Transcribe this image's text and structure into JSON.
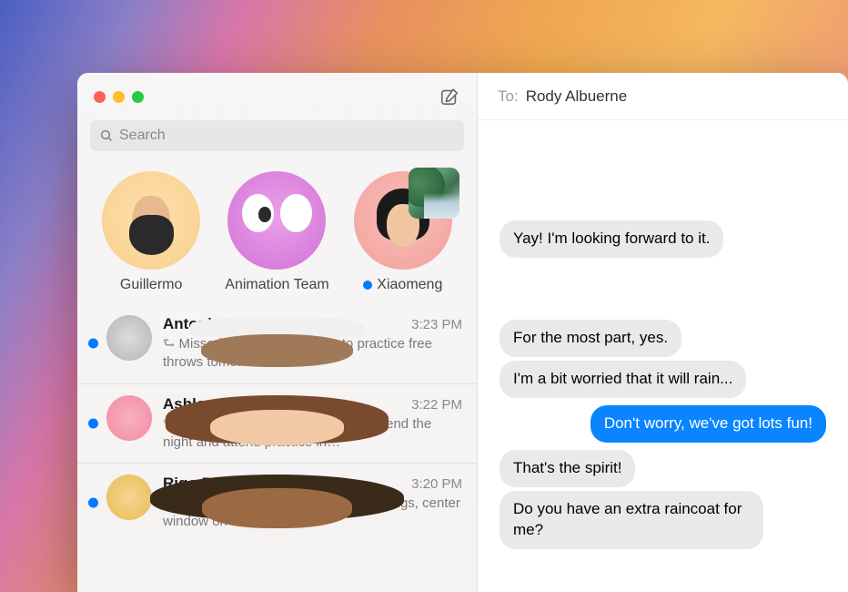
{
  "search": {
    "placeholder": "Search"
  },
  "pins": [
    {
      "label": "Guillermo",
      "unread": false
    },
    {
      "label": "Animation Team",
      "unread": false
    },
    {
      "label": "Xiaomeng",
      "unread": true
    }
  ],
  "conversations": [
    {
      "name": "Antonio Manriquez",
      "time": "3:23 PM",
      "preview": "Missed final basket; wants to practice free throws tomorrow.",
      "unread": true
    },
    {
      "name": "Ashley Rico",
      "time": "3:22 PM",
      "preview": "Confirmation needed if Will can spend the night and attend practice in…",
      "unread": true
    },
    {
      "name": "Rigo Rangel",
      "time": "3:20 PM",
      "preview": "Provide last minute tweaks to drawings, center window on desktop, fi…",
      "unread": true
    }
  ],
  "chat": {
    "to_label": "To:",
    "recipient": "Rody Albuerne",
    "messages": [
      {
        "dir": "in",
        "text": "Yay! I'm looking forward to it."
      },
      {
        "dir": "gap"
      },
      {
        "dir": "in",
        "text": "For the most part, yes."
      },
      {
        "dir": "in",
        "text": "I'm a bit worried that it will rain..."
      },
      {
        "dir": "out",
        "text": "Don't worry, we've got lots fun!"
      },
      {
        "dir": "in",
        "text": "That's the spirit!"
      },
      {
        "dir": "in",
        "text": "Do you have an extra raincoat for me?"
      }
    ]
  },
  "colors": {
    "accent": "#007aff",
    "outgoing": "#0a84ff",
    "incoming": "#e9e9eb"
  }
}
